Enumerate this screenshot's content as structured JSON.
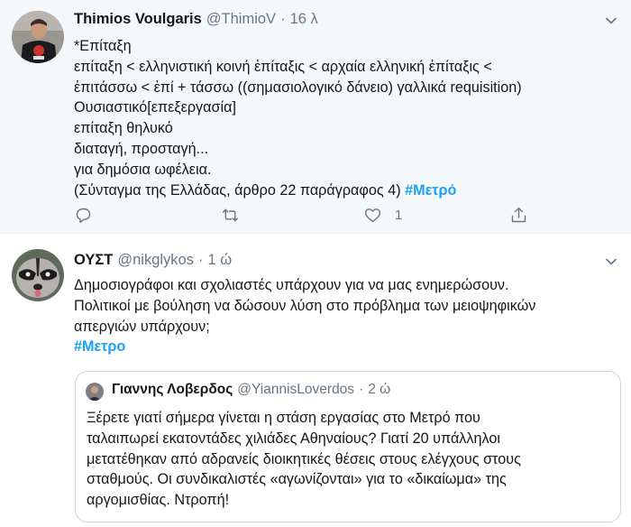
{
  "tweets": [
    {
      "author_name": "Thimios Voulgaris",
      "handle": "@ThimioV",
      "separator": "·",
      "time": "16 λ",
      "avatar_icon": "user-avatar-dark-shirt",
      "lines": [
        "*Επίταξη",
        "επίταξη < ελληνιστική κοινή ἐπίταξις < αρχαία ελληνική ἐπίταξις <",
        "ἐπιτάσσω < ἐπί + τάσσω ((σημασιολογικό δάνειο) γαλλικά requisition)",
        "Ουσιαστικό[επεξεργασία]",
        "επίταξη θηλυκό",
        "διαταγή, προσταγή...",
        "για δημόσια ωφέλεια.",
        "(Σύνταγμα της Ελλάδας, άρθρο 22 παράγραφος 4)"
      ],
      "hashtag": "#Μετρό",
      "actions": {
        "reply_count": "",
        "retweet_count": "",
        "like_count": "1",
        "reply_icon": "reply-icon",
        "retweet_icon": "retweet-icon",
        "like_icon": "heart-icon",
        "share_icon": "share-icon"
      }
    },
    {
      "author_name": "ΟΥΣΤ",
      "handle": "@nikglykos",
      "separator": "·",
      "time": "1 ώ",
      "avatar_icon": "raccoon-avatar",
      "lines": [
        "Δημοσιογράφοι και σχολιαστές υπάρχουν για να μας ενημερώσουν.",
        "Πολιτικοί με βούληση να δώσουν λύση στο πρόβλημα των μειοψηφικών",
        "απεργιών υπάρχουν;"
      ],
      "hashtag": "#Μετρο",
      "quoted": {
        "author_name": "Γιαννης Λοβερδος",
        "handle": "@YiannisLoverdos",
        "separator": "·",
        "time": "2 ώ",
        "avatar_icon": "small-user-avatar",
        "lines": [
          "Ξέρετε γιατί σήμερα γίνεται η στάση εργασίας στο Μετρό που",
          "ταλαιπωρεί εκατοντάδες χιλιάδες Αθηναίους? Γιατί 20 υπάλληλοι",
          "μετατέθηκαν από αδρανείς διοικητικές θέσεις στους ελέγχους στους",
          "σταθμούς. Οι συνδικαλιστές «αγωνίζονται» για το «δικαίωμα» της",
          "αργομισθίας. Ντροπή!"
        ]
      }
    }
  ],
  "colors": {
    "hashtag": "#1da1f2",
    "secondary_text": "#657786",
    "highlight_background": "#f5f8fa",
    "quote_border": "#ccd6dd"
  }
}
